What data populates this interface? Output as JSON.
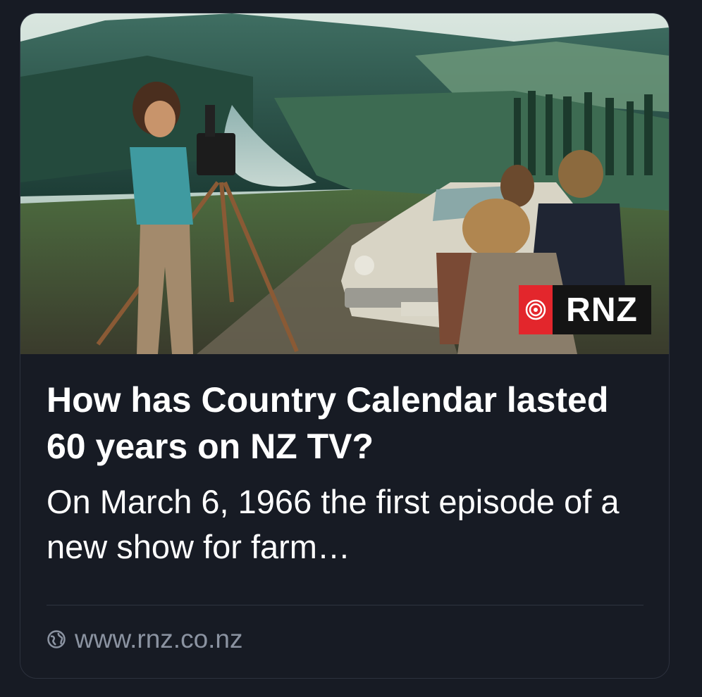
{
  "card": {
    "image": {
      "alt_icon": "rnz-photo",
      "badge": {
        "brand_label": "RNZ",
        "brand_color": "#e3262c",
        "icon": "rnz-swirl-icon"
      }
    },
    "headline": "How has Country Calendar lasted 60 years on NZ TV?",
    "summary": "On March 6, 1966 the first episode of a new show for farm…",
    "source": {
      "icon": "globe-icon",
      "domain": "www.rnz.co.nz"
    }
  },
  "colors": {
    "background": "#171b24",
    "border": "#2c313d",
    "muted_text": "#8b93a1",
    "text": "#ffffff"
  }
}
